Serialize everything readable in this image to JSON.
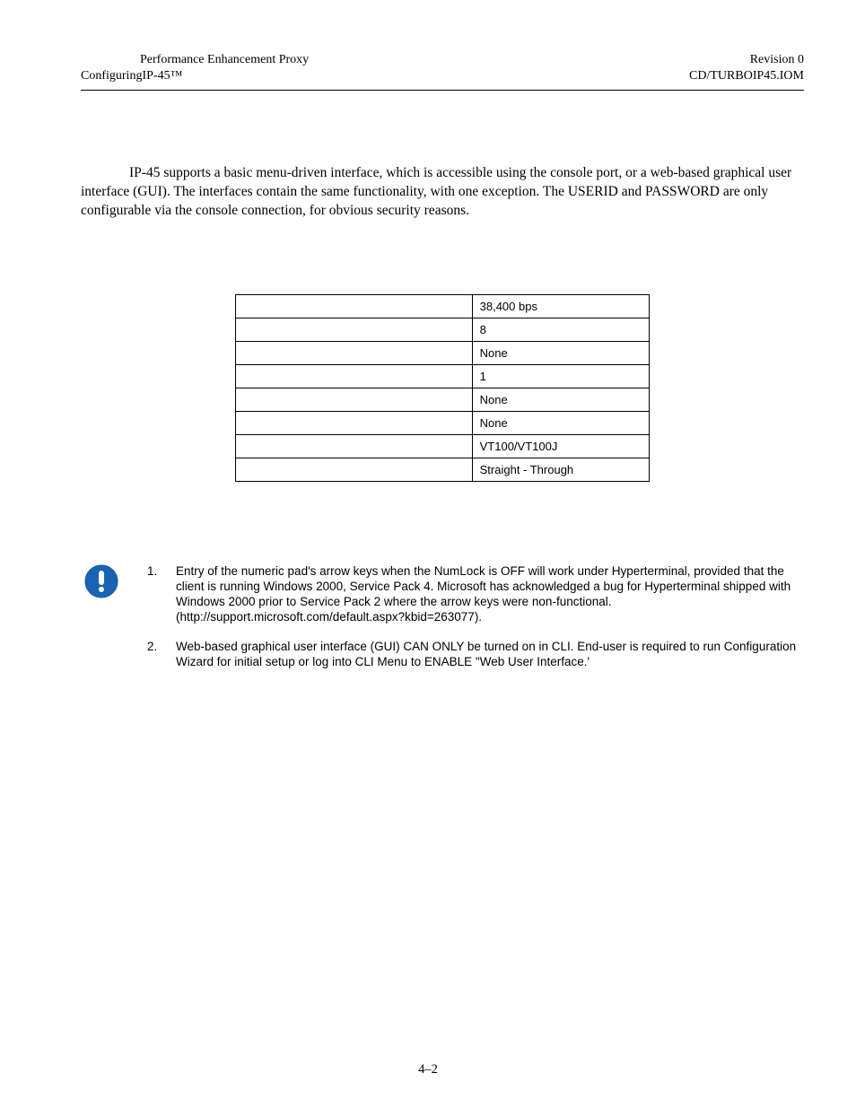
{
  "header": {
    "left_line1": "Performance Enhancement Proxy",
    "left_line2_a": "Configuring",
    "left_line2_b": "IP-45™",
    "right_line1": "Revision 0",
    "right_line2": "CD/TURBOIP45.IOM"
  },
  "intro_paragraph": "IP-45  supports a basic menu-driven interface, which is accessible using the console port, or a web-based graphical user interface (GUI). The interfaces contain the same functionality, with one exception. The USERID and PASSWORD are only configurable via the console connection, for obvious security reasons.",
  "table_rows": [
    {
      "label": "",
      "value": "38,400 bps"
    },
    {
      "label": "",
      "value": "8"
    },
    {
      "label": "",
      "value": "None"
    },
    {
      "label": "",
      "value": "1"
    },
    {
      "label": "",
      "value": "None"
    },
    {
      "label": "",
      "value": "None"
    },
    {
      "label": "",
      "value": "VT100/VT100J"
    },
    {
      "label": "",
      "value": "Straight - Through"
    }
  ],
  "notes": [
    {
      "num": "1.",
      "text": " Entry of the numeric pad's arrow keys when the NumLock is OFF will work under Hyperterminal, provided that the client is running Windows 2000, Service Pack 4.  Microsoft has acknowledged a bug for Hyperterminal shipped with Windows 2000 prior to Service Pack 2 where the arrow keys were non-functional. (http://support.microsoft.com/default.aspx?kbid=263077)."
    },
    {
      "num": "2.",
      "text": "Web-based graphical user interface (GUI) CAN ONLY be turned on in CLI. End-user is required to run Configuration Wizard for initial setup or log into CLI Menu to ENABLE \"Web User Interface.'"
    }
  ],
  "page_number": "4–2"
}
